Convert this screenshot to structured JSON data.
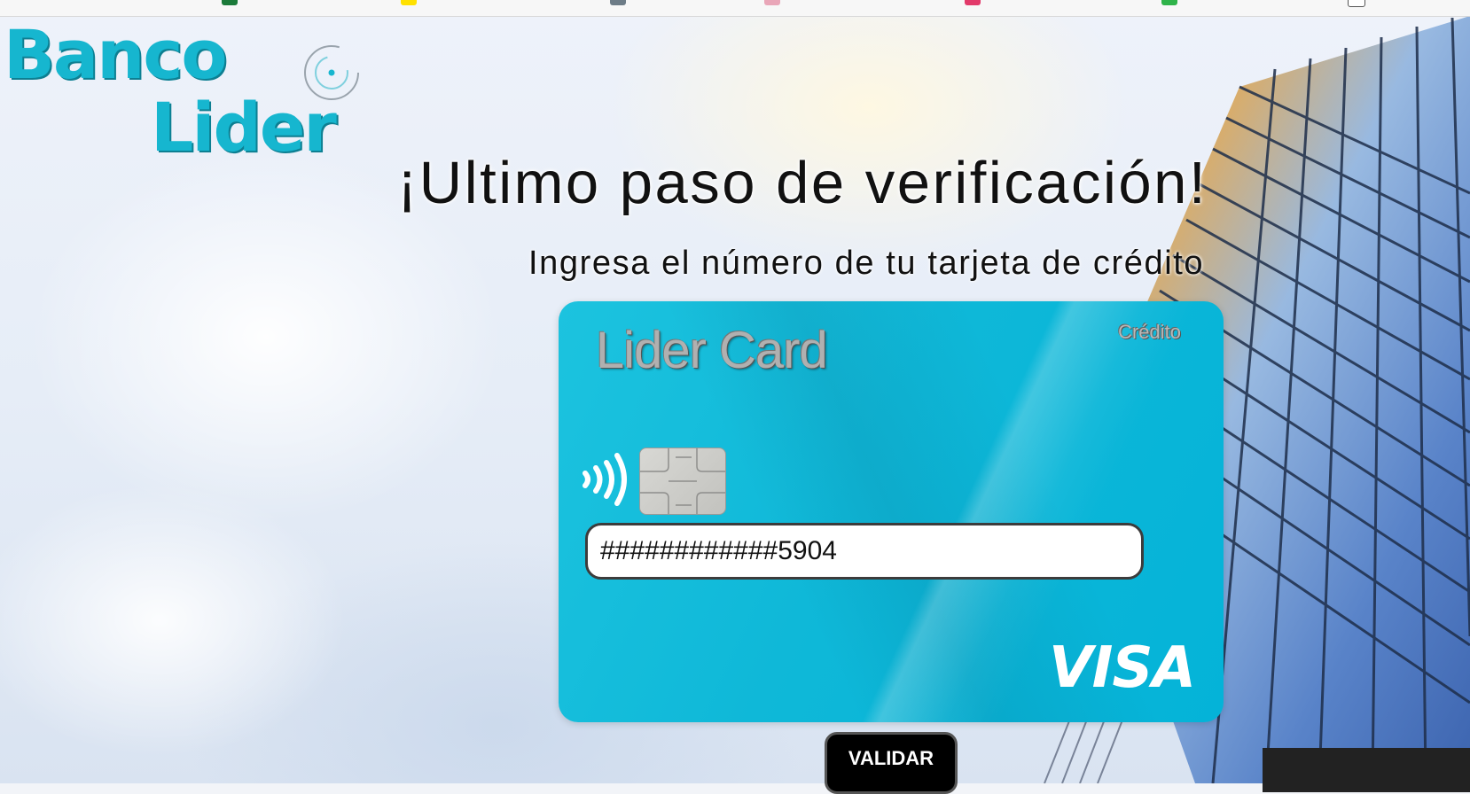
{
  "page": {
    "title": "¡Ultimo paso de verificación!",
    "subtitle": "Ingresa el número de tu tarjeta de crédito"
  },
  "logo": {
    "line1": "Banco",
    "line2": "Lider",
    "brand_color": "#16b6cf"
  },
  "card": {
    "brand": "Lider Card",
    "type": "Crédito",
    "network": "VISA",
    "color": "#0fb8d8",
    "number_input": {
      "value": "############5904"
    }
  },
  "actions": {
    "validate_label": "VALIDAR"
  }
}
